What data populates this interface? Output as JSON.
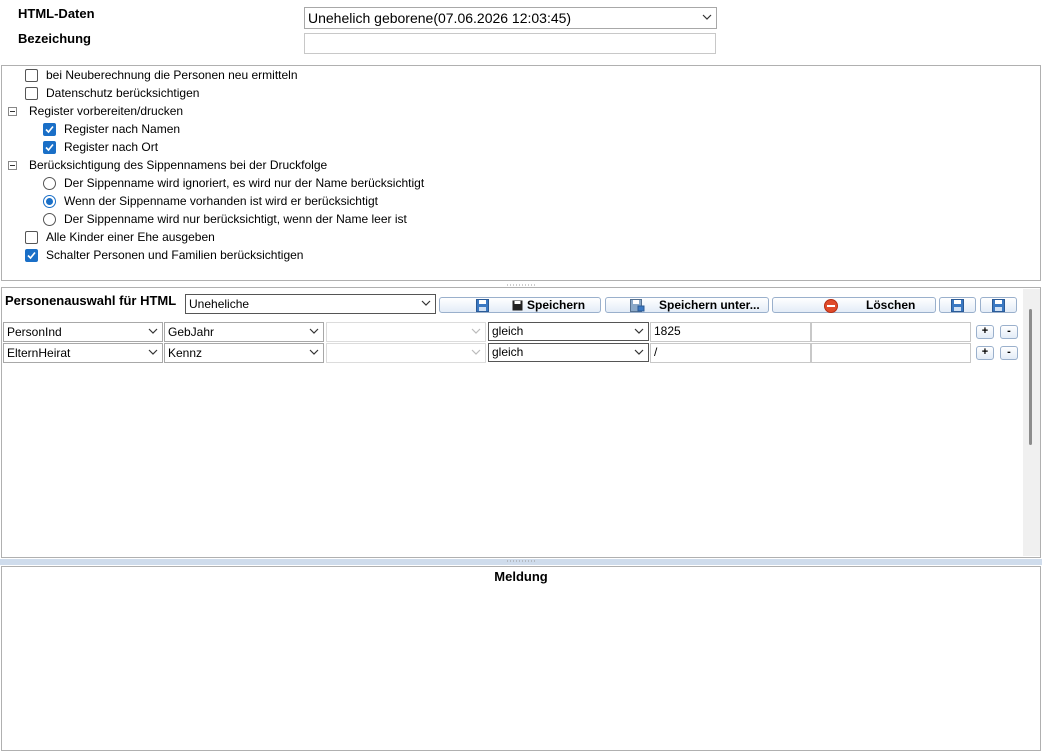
{
  "header": {
    "html_daten_label": "HTML-Daten",
    "bezeichnung_label": "Bezeichung",
    "html_daten_value": "Unehelich geborene(07.06.2026 12:03:45)",
    "bezeichnung_value": ""
  },
  "options": {
    "neuberechnung": {
      "label": "bei Neuberechnung die Personen neu ermitteln",
      "checked": false
    },
    "datenschutz": {
      "label": "Datenschutz berücksichtigen",
      "checked": false
    },
    "register_group": "Register vorbereiten/drucken",
    "register_namen": {
      "label": "Register nach Namen",
      "checked": true
    },
    "register_ort": {
      "label": "Register nach Ort",
      "checked": true
    },
    "sippen_group": "Berücksichtigung des Sippennamens bei der Druckfolge",
    "sippen_radio": [
      {
        "label": "Der Sippenname wird ignoriert, es wird nur der Name berücksichtigt",
        "checked": false
      },
      {
        "label": "Wenn der Sippenname vorhanden ist wird er berücksichtigt",
        "checked": true
      },
      {
        "label": "Der Sippenname wird nur berücksichtigt, wenn der Name leer ist",
        "checked": false
      }
    ],
    "alle_kinder": {
      "label": "Alle Kinder einer Ehe ausgeben",
      "checked": false
    },
    "schalter": {
      "label": "Schalter Personen und Familien berücksichtigen",
      "checked": true
    }
  },
  "selection": {
    "title": "Personenauswahl für HTML",
    "selected": "Uneheliche",
    "save_label": "Speichern",
    "save_as_label": "Speichern unter...",
    "delete_label": "Löschen",
    "rows": [
      {
        "field": "PersonInd",
        "attribute": "GebJahr",
        "extra": "",
        "operator": "gleich",
        "value": "1825"
      },
      {
        "field": "ElternHeirat",
        "attribute": "Kennz",
        "extra": "",
        "operator": "gleich",
        "value": "/"
      }
    ],
    "plus": "+",
    "minus": "-"
  },
  "message": {
    "title": "Meldung"
  },
  "colors": {
    "accent": "#1a6fc7",
    "separator": "#cfdcec"
  }
}
